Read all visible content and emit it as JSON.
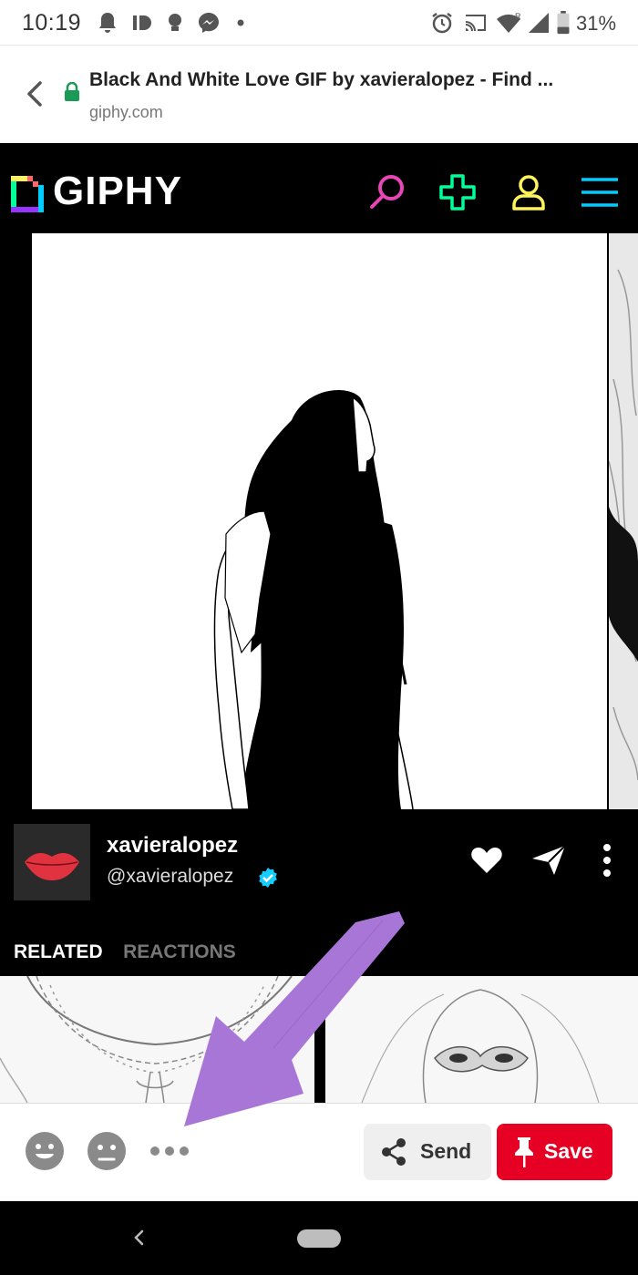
{
  "status_bar": {
    "time": "10:19",
    "battery": "31%"
  },
  "url_bar": {
    "title": "Black And White Love GIF by xavieralopez - Find ...",
    "domain": "giphy.com"
  },
  "giphy": {
    "logo_text": "GIPHY",
    "header_icons": [
      "search-icon",
      "plus-icon",
      "user-icon",
      "menu-icon"
    ],
    "header_icon_colors": {
      "search": "#e646b6",
      "plus": "#00ff99",
      "user": "#fff35c",
      "menu": "#00ccff"
    },
    "creator": {
      "display_name": "xavieralopez",
      "handle": "@xavieralopez",
      "verified_color": "#15cdff"
    },
    "tabs": {
      "related": "RELATED",
      "reactions": "REACTIONS"
    }
  },
  "share_bar": {
    "send_label": "Send",
    "save_label": "Save",
    "save_color": "#e60023",
    "reaction_icons": [
      "smiley-face-icon",
      "sad-face-icon",
      "more-options-icon"
    ]
  },
  "annotation": {
    "arrow_color": "#a876d6"
  }
}
